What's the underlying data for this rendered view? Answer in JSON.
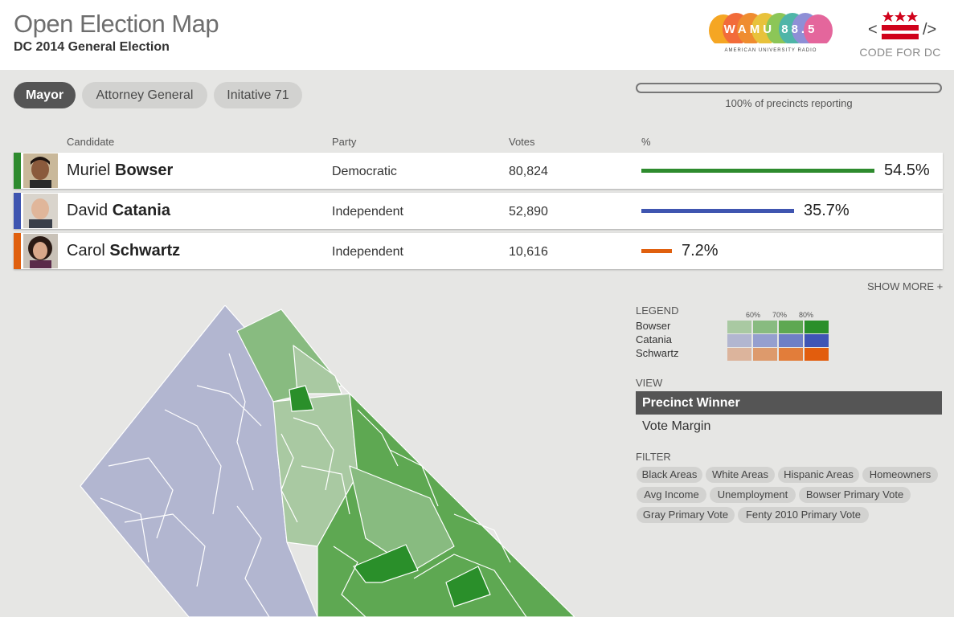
{
  "header": {
    "title": "Open Election Map",
    "subtitle": "DC 2014 General Election",
    "wamu": {
      "name": "WAMU 88.5",
      "tagline": "AMERICAN UNIVERSITY RADIO"
    },
    "cfdc": {
      "name": "CODE FOR DC"
    }
  },
  "tabs": [
    {
      "label": "Mayor",
      "active": true
    },
    {
      "label": "Attorney General",
      "active": false
    },
    {
      "label": "Initative 71",
      "active": false
    }
  ],
  "progress": {
    "reporting_fraction": 1.0,
    "label": "100% of precincts reporting"
  },
  "table": {
    "headers": {
      "candidate": "Candidate",
      "party": "Party",
      "votes": "Votes",
      "pct": "%"
    },
    "rows": [
      {
        "first": "Muriel",
        "last": "Bowser",
        "party": "Democratic",
        "votes": "80,824",
        "pct": "54.5%",
        "pct_value": 54.5,
        "color": "#2e8b2e"
      },
      {
        "first": "David",
        "last": "Catania",
        "party": "Independent",
        "votes": "52,890",
        "pct": "35.7%",
        "pct_value": 35.7,
        "color": "#3f55b0"
      },
      {
        "first": "Carol",
        "last": "Schwartz",
        "party": "Independent",
        "votes": "10,616",
        "pct": "7.2%",
        "pct_value": 7.2,
        "color": "#e0600e"
      }
    ]
  },
  "show_more": "SHOW MORE +",
  "legend": {
    "title": "LEGEND",
    "thresholds": [
      "60%",
      "70%",
      "80%"
    ],
    "rows": [
      {
        "name": "Bowser",
        "colors": [
          "#a9c9a2",
          "#88bb80",
          "#5ea852",
          "#2a8f2a"
        ]
      },
      {
        "name": "Catania",
        "colors": [
          "#b2b6d0",
          "#959fcf",
          "#6f7fc6",
          "#3f55b5"
        ]
      },
      {
        "name": "Schwartz",
        "colors": [
          "#dcb49c",
          "#dd9a6c",
          "#e27d3a",
          "#e25d0d"
        ]
      }
    ]
  },
  "view": {
    "title": "VIEW",
    "options": [
      {
        "label": "Precinct Winner",
        "active": true
      },
      {
        "label": "Vote Margin",
        "active": false
      }
    ]
  },
  "filter": {
    "title": "FILTER",
    "chips": [
      "Black Areas",
      "White Areas",
      "Hispanic Areas",
      "Homeowners",
      "Avg Income",
      "Unemployment",
      "Bowser Primary Vote",
      "Gray Primary Vote",
      "Fenty 2010 Primary Vote"
    ]
  }
}
